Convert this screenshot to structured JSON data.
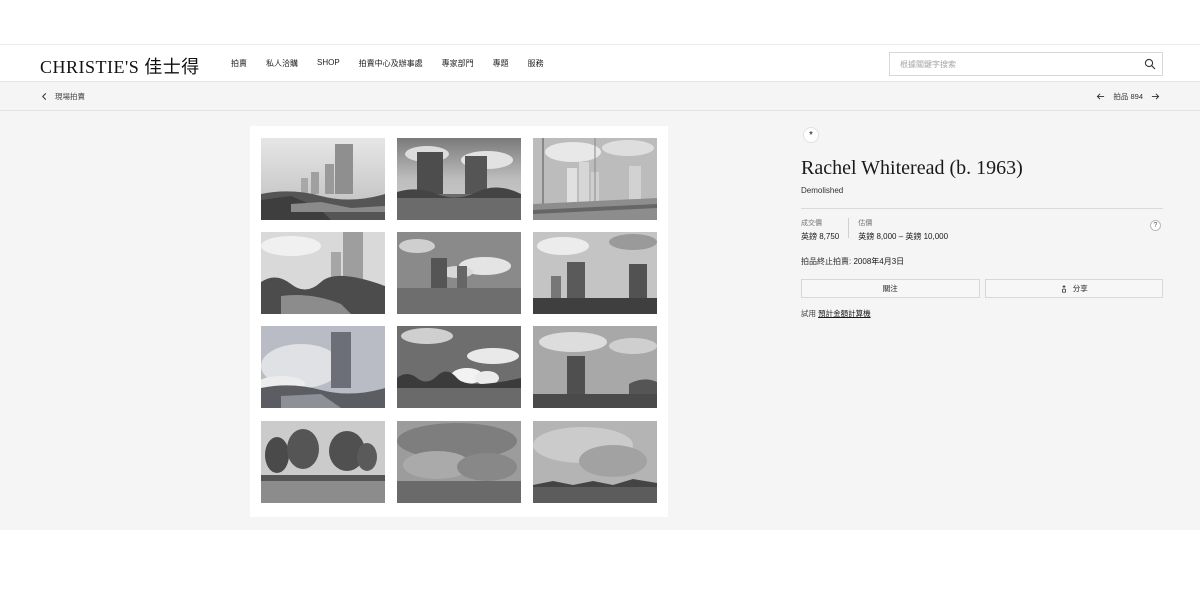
{
  "header": {
    "logo": "CHRISTIE'S 佳士得",
    "nav": [
      "拍賣",
      "私人洽購",
      "SHOP",
      "拍賣中心及辦事處",
      "專家部門",
      "專題",
      "服務"
    ],
    "search_placeholder": "根據關鍵字搜索"
  },
  "subbar": {
    "back_label": "現場拍賣",
    "lot_label": "拍品 894"
  },
  "lot": {
    "badge": "*",
    "artist": "Rachel Whiteread (b. 1963)",
    "title": "Demolished",
    "sold_label": "成交價",
    "sold_value": "英鎊 8,750",
    "estimate_label": "估價",
    "estimate_value": "英鎊 8,000 – 英鎊 10,000",
    "help": "?",
    "close_label": "拍品終止拍賣:",
    "close_value": "2008年4月3日",
    "follow_label": "關注",
    "share_label": "分享",
    "calc_prefix": "試用",
    "calc_link": "預計金額計算機"
  },
  "colors": {
    "page_bg": "#f5f5f5",
    "header_bg": "#ffffff",
    "text": "#1a1a1a"
  }
}
